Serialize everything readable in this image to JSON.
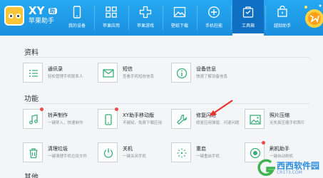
{
  "app": {
    "name": "XY",
    "name_tag": "助",
    "subtitle": "苹果助手"
  },
  "nav": [
    {
      "label": "我的设备",
      "icon": "phone-icon"
    },
    {
      "label": "苹果应用",
      "icon": "apps-grid-icon"
    },
    {
      "label": "苹果游戏",
      "icon": "gamepad-icon"
    },
    {
      "label": "壁纸下载",
      "icon": "picture-icon"
    },
    {
      "label": "手机柱能",
      "icon": "plus-circle-icon"
    },
    {
      "label": "工具箱",
      "icon": "toolbox-icon"
    },
    {
      "label": "越狱助手",
      "icon": "jailbreak-icon"
    }
  ],
  "sections": {
    "data": {
      "title": "资料",
      "cards": [
        {
          "title": "通讯录",
          "desc": "轻松管理手机联系人",
          "icon": "contacts-list-icon"
        },
        {
          "title": "短信",
          "desc": "查看手机短信信息",
          "icon": "sms-envelope-icon"
        },
        {
          "title": "设备信息",
          "desc": "快速了解设备信息",
          "icon": "device-info-icon"
        }
      ]
    },
    "features": {
      "title": "功能",
      "cards": [
        {
          "title": "铃声制作",
          "desc": "一键导入，快速制作",
          "icon": "music-note-icon",
          "dot": true
        },
        {
          "title": "XY助手移动版",
          "desc": "不越狱，免费下载应用",
          "icon": "mobile-app-icon",
          "dot": true
        },
        {
          "title": "修复闪退",
          "desc": "修复应用弹窗、闪退问题",
          "icon": "wrench-icon"
        },
        {
          "title": "照片压缩",
          "desc": "无失真压缩手机照片",
          "icon": "photo-compress-icon"
        },
        {
          "title": "清理垃圾",
          "desc": "一键清理手机垃圾文件",
          "icon": "trash-icon"
        },
        {
          "title": "关机",
          "desc": "一键关闭手机",
          "icon": "power-icon"
        },
        {
          "title": "重启",
          "desc": "一键重启手机",
          "icon": "restart-icon"
        },
        {
          "title": "刷机助手",
          "desc": "一键自动刷机",
          "icon": "flash-icon",
          "dot": true
        }
      ]
    },
    "other": {
      "title": "其他"
    }
  },
  "watermark": {
    "text": "西西软件园",
    "sub": "CR173.COM"
  },
  "colors": {
    "topbar": "#1b8fdf",
    "accent_green": "#3aae7a",
    "dot_red": "#f04848",
    "arrow_red": "#e8322e"
  }
}
